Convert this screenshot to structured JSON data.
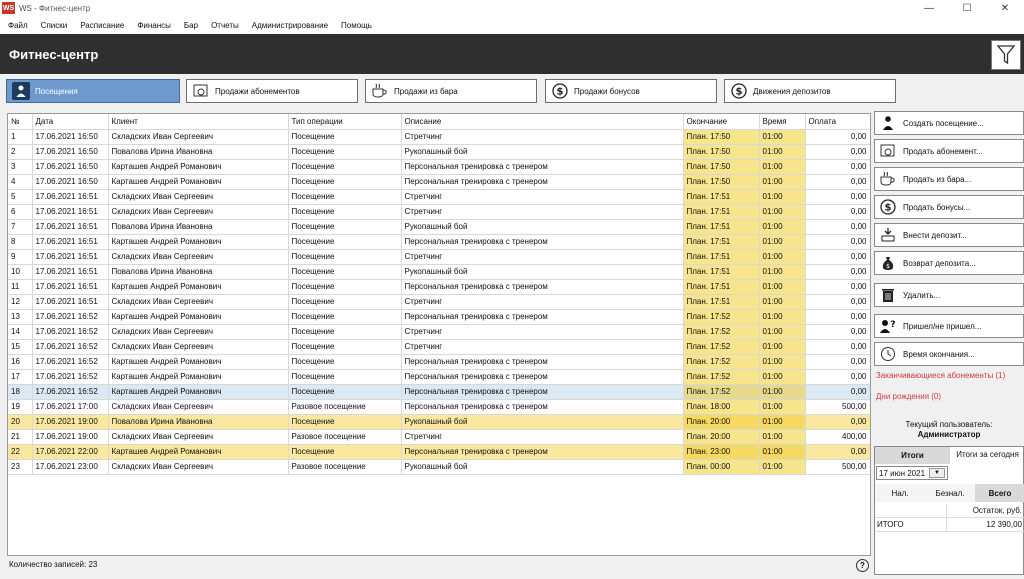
{
  "window": {
    "title": "WS - Фитнес-центр",
    "app_icon": "WS"
  },
  "menu": [
    "Файл",
    "Списки",
    "Расписание",
    "Финансы",
    "Бар",
    "Отчеты",
    "Администрирование",
    "Помощь"
  ],
  "header": {
    "title": "Фитнес-центр"
  },
  "tabs": [
    {
      "label": "Посещения",
      "icon": "visitor-icon",
      "active": true
    },
    {
      "label": "Продажи абонементов",
      "icon": "card-icon",
      "active": false
    },
    {
      "label": "Продажи из бара",
      "icon": "cup-icon",
      "active": false
    },
    {
      "label": "Продажи бонусов",
      "icon": "dollar-icon",
      "active": false
    },
    {
      "label": "Движения депозитов",
      "icon": "dollar-icon",
      "active": false
    }
  ],
  "table": {
    "columns": [
      "№",
      "Дата",
      "Клиент",
      "Тип операции",
      "Описание",
      "Окончание",
      "Время",
      "Оплата"
    ],
    "rows": [
      [
        "1",
        "17.06.2021 16:50",
        "Складских Иван Сергеевич",
        "Посещение",
        "Стретчинг",
        "План. 17:50",
        "01:00",
        "0,00"
      ],
      [
        "2",
        "17.06.2021 16:50",
        "Повалова Ирина Ивановна",
        "Посещение",
        "Рукопашный бой",
        "План. 17:50",
        "01:00",
        "0,00"
      ],
      [
        "3",
        "17.06.2021 16:50",
        "Карташев Андрей Романович",
        "Посещение",
        "Персональная тренировка с тренером",
        "План. 17:50",
        "01:00",
        "0,00"
      ],
      [
        "4",
        "17.06.2021 16:50",
        "Карташев Андрей Романович",
        "Посещение",
        "Персональная тренировка с тренером",
        "План. 17:50",
        "01:00",
        "0,00"
      ],
      [
        "5",
        "17.06.2021 16:51",
        "Складских Иван Сергеевич",
        "Посещение",
        "Стретчинг",
        "План. 17:51",
        "01:00",
        "0,00"
      ],
      [
        "6",
        "17.06.2021 16:51",
        "Складских Иван Сергеевич",
        "Посещение",
        "Стретчинг",
        "План. 17:51",
        "01:00",
        "0,00"
      ],
      [
        "7",
        "17.06.2021 16:51",
        "Повалова Ирина Ивановна",
        "Посещение",
        "Рукопашный бой",
        "План. 17:51",
        "01:00",
        "0,00"
      ],
      [
        "8",
        "17.06.2021 16:51",
        "Карташев Андрей Романович",
        "Посещение",
        "Персональная тренировка с тренером",
        "План. 17:51",
        "01:00",
        "0,00"
      ],
      [
        "9",
        "17.06.2021 16:51",
        "Складских Иван Сергеевич",
        "Посещение",
        "Стретчинг",
        "План. 17:51",
        "01:00",
        "0,00"
      ],
      [
        "10",
        "17.06.2021 16:51",
        "Повалова Ирина Ивановна",
        "Посещение",
        "Рукопашный бой",
        "План. 17:51",
        "01:00",
        "0,00"
      ],
      [
        "11",
        "17.06.2021 16:51",
        "Карташев Андрей Романович",
        "Посещение",
        "Персональная тренировка с тренером",
        "План. 17:51",
        "01:00",
        "0,00"
      ],
      [
        "12",
        "17.06.2021 16:51",
        "Складских Иван Сергеевич",
        "Посещение",
        "Стретчинг",
        "План. 17:51",
        "01:00",
        "0,00"
      ],
      [
        "13",
        "17.06.2021 16:52",
        "Карташев Андрей Романович",
        "Посещение",
        "Персональная тренировка с тренером",
        "План. 17:52",
        "01:00",
        "0,00"
      ],
      [
        "14",
        "17.06.2021 16:52",
        "Складских Иван Сергеевич",
        "Посещение",
        "Стретчинг",
        "План. 17:52",
        "01:00",
        "0,00"
      ],
      [
        "15",
        "17.06.2021 16:52",
        "Складских Иван Сергеевич",
        "Посещение",
        "Стретчинг",
        "План. 17:52",
        "01:00",
        "0,00"
      ],
      [
        "16",
        "17.06.2021 16:52",
        "Карташев Андрей Романович",
        "Посещение",
        "Персональная тренировка с тренером",
        "План. 17:52",
        "01:00",
        "0,00"
      ],
      [
        "17",
        "17.06.2021 16:52",
        "Карташев Андрей Романович",
        "Посещение",
        "Персональная тренировка с тренером",
        "План. 17:52",
        "01:00",
        "0,00"
      ],
      [
        "18",
        "17.06.2021 16:52",
        "Карташев Андрей Романович",
        "Посещение",
        "Персональная тренировка с тренером",
        "План. 17:52",
        "01:00",
        "0,00"
      ],
      [
        "19",
        "17.06.2021 17:00",
        "Складских Иван Сергеевич",
        "Разовое посещение",
        "Персональная тренировка с тренером",
        "План. 18:00",
        "01:00",
        "500,00"
      ],
      [
        "20",
        "17.06.2021 19:00",
        "Повалова Ирина Ивановна",
        "Посещение",
        "Рукопашный бой",
        "План. 20:00",
        "01:00",
        "0,00"
      ],
      [
        "21",
        "17.06.2021 19:00",
        "Складских Иван Сергеевич",
        "Разовое посещение",
        "Стретчинг",
        "План. 20:00",
        "01:00",
        "400,00"
      ],
      [
        "22",
        "17.06.2021 22:00",
        "Карташев Андрей Романович",
        "Посещение",
        "Персональная тренировка с тренером",
        "План. 23:00",
        "01:00",
        "0,00"
      ],
      [
        "23",
        "17.06.2021 23:00",
        "Складских Иван Сергеевич",
        "Разовое посещение",
        "Рукопашный бой",
        "План. 00:00",
        "01:00",
        "500,00"
      ]
    ],
    "highlighted_rows": [
      "20",
      "22"
    ],
    "selected_row": "18"
  },
  "footer": {
    "record_count": "Количество записей: 23"
  },
  "actions": [
    {
      "label": "Создать посещение...",
      "icon": "visitor-icon"
    },
    {
      "label": "Продать абонемент...",
      "icon": "card-icon"
    },
    {
      "label": "Продать из бара...",
      "icon": "cup-icon"
    },
    {
      "label": "Продать бонусы...",
      "icon": "dollar-icon"
    },
    {
      "label": "Внести депозит...",
      "icon": "deposit-in-icon"
    },
    {
      "label": "Возврат депозита...",
      "icon": "money-bag-icon"
    },
    {
      "label": "Удалить...",
      "icon": "trash-icon"
    },
    {
      "label": "Пришел/не пришел...",
      "icon": "person-question-icon"
    },
    {
      "label": "Время окончания...",
      "icon": "clock-icon"
    }
  ],
  "links": {
    "expiring": "Заканчивающиеся абонементы (1)",
    "birthdays": "Дни рождения (0)"
  },
  "current_user": {
    "label": "Текущий пользователь:",
    "name": "Администратор"
  },
  "totals": {
    "tab_totals": "Итоги",
    "tab_today": "Итоги за сегодня",
    "date": "17 июн 2021",
    "pay_tabs": [
      "Нал.",
      "Безнал.",
      "Всего"
    ],
    "header_value": "Остаток, руб.",
    "row_label": "ИТОГО",
    "row_value": "12 390,00"
  },
  "colors": {
    "accent": "#6d99cd",
    "highlight": "#f6e58d",
    "link_red": "#d03a3a",
    "header_bg": "#2f2f2f"
  }
}
